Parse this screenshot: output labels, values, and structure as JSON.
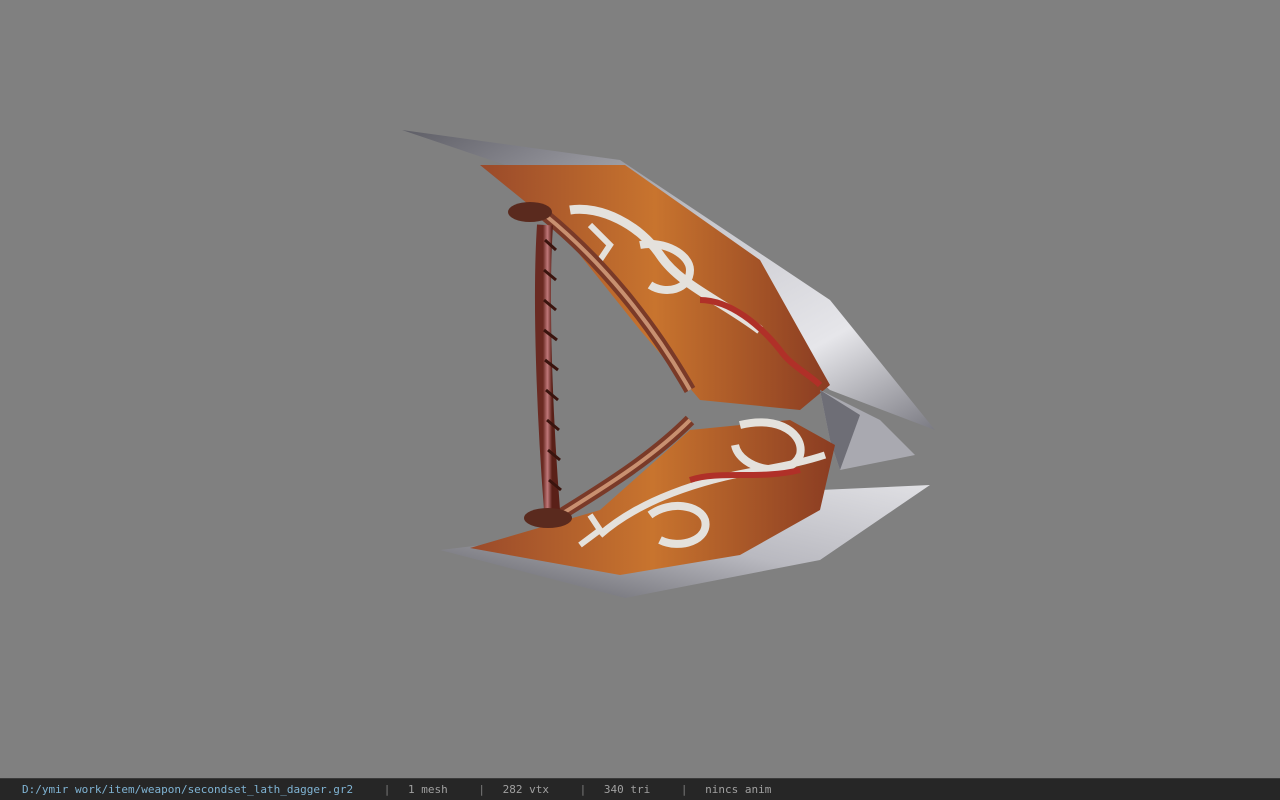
{
  "viewer": {
    "background_color": "#808080",
    "model_icon": "lath-dagger-3d-model"
  },
  "status_bar": {
    "file_path": "D:/ymir work/item/weapon/secondset_lath_dagger.gr2",
    "separator": "|",
    "mesh_count": "1 mesh",
    "vertex_count": "282 vtx",
    "triangle_count": "340 tri",
    "animation": "nincs anim",
    "colors": {
      "background": "#262626",
      "path": "#7fb3d3",
      "text": "#a0a0a0"
    }
  }
}
